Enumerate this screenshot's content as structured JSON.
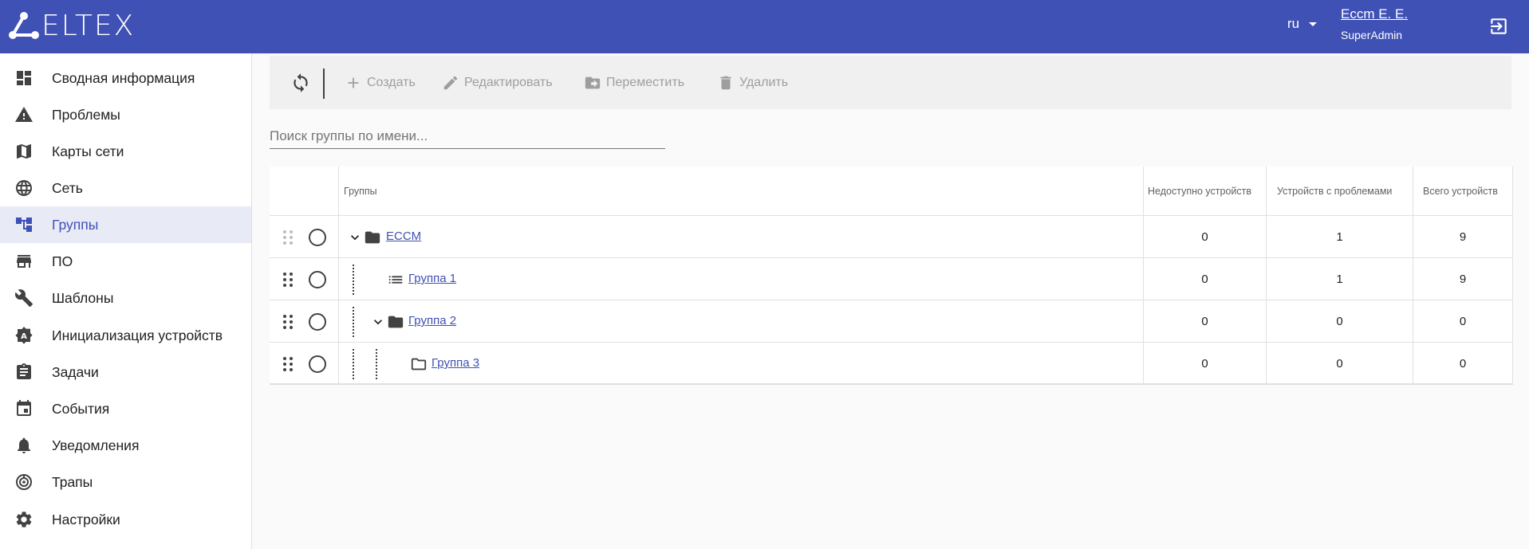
{
  "header": {
    "logo_text": "ELTEX",
    "lang": "ru",
    "user_name": "Eccm E. E.",
    "user_role": "SuperAdmin"
  },
  "sidebar": {
    "items": [
      {
        "label": "Сводная информация",
        "icon": "dashboard-icon"
      },
      {
        "label": "Проблемы",
        "icon": "warning-icon"
      },
      {
        "label": "Карты сети",
        "icon": "map-icon"
      },
      {
        "label": "Сеть",
        "icon": "globe-icon"
      },
      {
        "label": "Группы",
        "icon": "groups-tree-icon",
        "active": true
      },
      {
        "label": "ПО",
        "icon": "store-icon"
      },
      {
        "label": "Шаблоны",
        "icon": "wrench-icon"
      },
      {
        "label": "Инициализация устройств",
        "icon": "auto-init-icon"
      },
      {
        "label": "Задачи",
        "icon": "clipboard-icon"
      },
      {
        "label": "События",
        "icon": "calendar-icon"
      },
      {
        "label": "Уведомления",
        "icon": "bell-icon"
      },
      {
        "label": "Трапы",
        "icon": "trap-icon"
      },
      {
        "label": "Настройки",
        "icon": "gear-icon"
      }
    ]
  },
  "toolbar": {
    "create": "Создать",
    "edit": "Редактировать",
    "move": "Переместить",
    "delete": "Удалить"
  },
  "search": {
    "placeholder": "Поиск группы по имени..."
  },
  "table": {
    "columns": [
      "Группы",
      "Недоступно устройств",
      "Устройств с проблемами",
      "Всего устройств"
    ],
    "rows": [
      {
        "name": "ECCM",
        "unavailable": "0",
        "problems": "1",
        "total": "9",
        "type": "folder",
        "expanded": true,
        "depth": 0
      },
      {
        "name": "Группа 1",
        "unavailable": "0",
        "problems": "1",
        "total": "9",
        "type": "list",
        "depth": 1
      },
      {
        "name": "Группа 2",
        "unavailable": "0",
        "problems": "0",
        "total": "0",
        "type": "folder",
        "expanded": true,
        "depth": 1
      },
      {
        "name": "Группа 3",
        "unavailable": "0",
        "problems": "0",
        "total": "0",
        "type": "folder-outline",
        "depth": 2
      }
    ]
  },
  "colors": {
    "primary": "#3f51b5",
    "active_bg": "#e8eaf6",
    "disabled": "#9e9e9e"
  }
}
